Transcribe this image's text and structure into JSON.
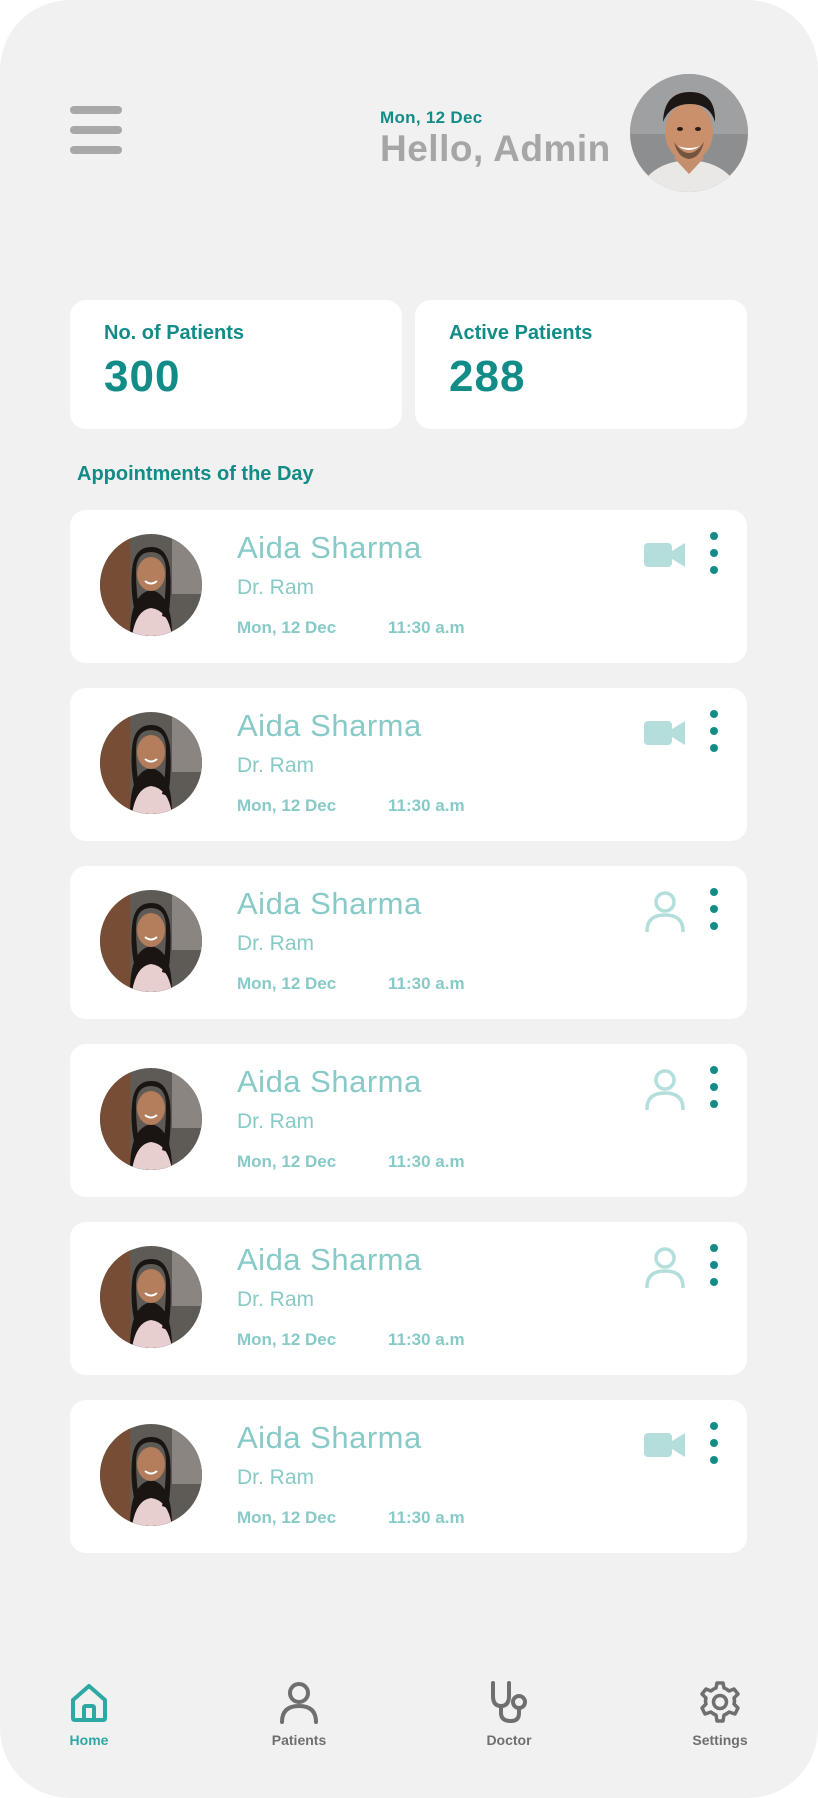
{
  "header": {
    "date": "Mon, 12 Dec",
    "greeting": "Hello, Admin",
    "menu_icon": "hamburger-menu-icon",
    "avatar": "admin-avatar"
  },
  "stats": [
    {
      "label": "No. of Patients",
      "value": "300"
    },
    {
      "label": "Active Patients",
      "value": "288"
    }
  ],
  "appointments_title": "Appointments of the Day",
  "appointments": [
    {
      "name": "Aida Sharma",
      "doctor": "Dr. Ram",
      "date": "Mon, 12 Dec",
      "time": "11:30 a.m",
      "type_icon": "video-camera-icon"
    },
    {
      "name": "Aida Sharma",
      "doctor": "Dr. Ram",
      "date": "Mon, 12 Dec",
      "time": "11:30 a.m",
      "type_icon": "video-camera-icon"
    },
    {
      "name": "Aida Sharma",
      "doctor": "Dr. Ram",
      "date": "Mon, 12 Dec",
      "time": "11:30 a.m",
      "type_icon": "person-icon"
    },
    {
      "name": "Aida Sharma",
      "doctor": "Dr. Ram",
      "date": "Mon, 12 Dec",
      "time": "11:30 a.m",
      "type_icon": "person-icon"
    },
    {
      "name": "Aida Sharma",
      "doctor": "Dr. Ram",
      "date": "Mon, 12 Dec",
      "time": "11:30 a.m",
      "type_icon": "person-icon"
    },
    {
      "name": "Aida Sharma",
      "doctor": "Dr. Ram",
      "date": "Mon, 12 Dec",
      "time": "11:30 a.m",
      "type_icon": "video-camera-icon"
    }
  ],
  "nav": [
    {
      "label": "Home",
      "icon": "home-icon",
      "active": true
    },
    {
      "label": "Patients",
      "icon": "person-icon",
      "active": false
    },
    {
      "label": "Doctor",
      "icon": "stethoscope-icon",
      "active": false
    },
    {
      "label": "Settings",
      "icon": "gear-icon",
      "active": false
    }
  ],
  "colors": {
    "background": "#f1f1f1",
    "card": "#ffffff",
    "accent": "#128c87",
    "accent_light": "#87cac7",
    "muted": "#a6a6a6"
  }
}
